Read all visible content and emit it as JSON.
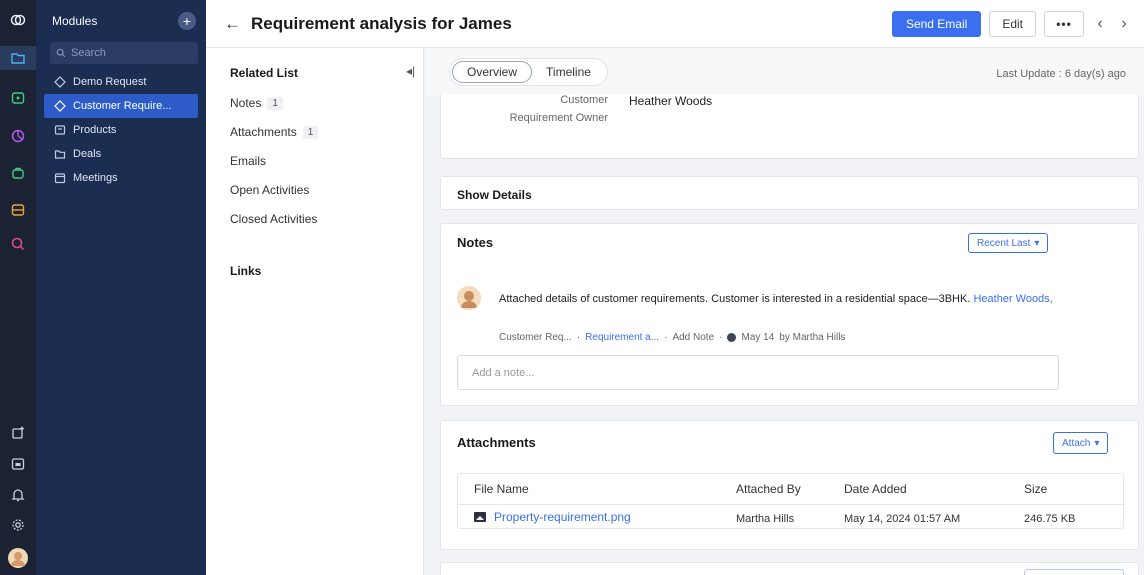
{
  "sidebar": {
    "title": "Modules",
    "add_label": "+",
    "search_placeholder": "Search",
    "items": [
      {
        "label": "Demo Request"
      },
      {
        "label": "Customer Require..."
      },
      {
        "label": "Products"
      },
      {
        "label": "Deals"
      },
      {
        "label": "Meetings"
      }
    ]
  },
  "header": {
    "back": "←",
    "title": "Requirement analysis for James",
    "send_email": "Send Email",
    "edit": "Edit",
    "more": "•••",
    "prev": "‹",
    "next": "›"
  },
  "related": {
    "heading": "Related List",
    "collapse": "◂|",
    "items": [
      {
        "label": "Notes",
        "count": "1"
      },
      {
        "label": "Attachments",
        "count": "1"
      },
      {
        "label": "Emails",
        "count": ""
      },
      {
        "label": "Open Activities",
        "count": ""
      },
      {
        "label": "Closed Activities",
        "count": ""
      }
    ],
    "links_heading": "Links"
  },
  "tabs": {
    "overview": "Overview",
    "timeline": "Timeline",
    "last_update": "Last Update : 6 day(s) ago"
  },
  "fields": {
    "customer_label": "Customer",
    "customer_value": "Heather Woods",
    "owner_label": "Requirement Owner"
  },
  "show_details": "Show Details",
  "notes": {
    "title": "Notes",
    "sort_label": "Recent Last",
    "note_text": "Attached details of customer requirements. Customer is interested in a residential space—3BHK.",
    "note_link": "Heather Woods,",
    "meta_module": "Customer Req...",
    "meta_record": "Requirement a...",
    "meta_add": "Add Note",
    "meta_date": "May 14",
    "meta_by": "by Martha Hills",
    "input_placeholder": "Add a note..."
  },
  "attachments": {
    "title": "Attachments",
    "attach_label": "Attach",
    "columns": [
      "File Name",
      "Attached By",
      "Date Added",
      "Size"
    ],
    "rows": [
      {
        "file": "Property-requirement.png",
        "by": "Martha Hills",
        "date": "May 14, 2024 01:57 AM",
        "size": "246.75 KB"
      }
    ]
  },
  "colors": {
    "accent": "#3a6ff0",
    "sidebar_bg": "#1c2d52",
    "rail_bg": "#1a2233"
  }
}
